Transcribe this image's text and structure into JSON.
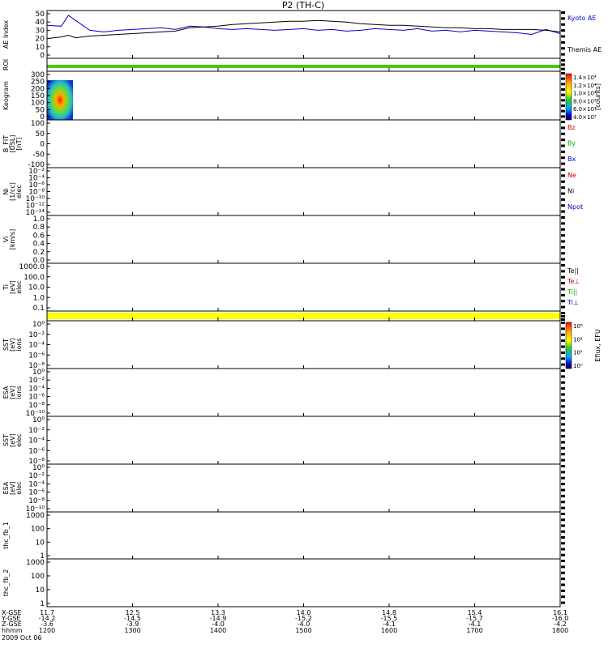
{
  "title": "P2 (TH-C)",
  "colors": {
    "kyoto": "#0000cc",
    "themis": "#000000",
    "bz": "#cc0000",
    "by": "#00aa00",
    "bx": "#0000cc",
    "ne": "#cc0000",
    "ni": "#000000",
    "npot": "#0000cc",
    "tepar": "#000000",
    "teperp": "#cc0000",
    "tipar": "#00aa00",
    "tiperp": "#0000cc",
    "roi_bar": "#44cc00",
    "mode_bar": "#ffff00"
  },
  "panels": [
    {
      "id": "ae",
      "label_lines": [
        "AE Index"
      ],
      "ticks": [
        "50",
        "40",
        "30",
        "20",
        "10",
        "0"
      ],
      "legend": [
        {
          "text": "Kyoto AE",
          "color": "#0000cc"
        },
        {
          "text": "Themis AE",
          "color": "#000000"
        }
      ]
    },
    {
      "id": "roi",
      "label_lines": [
        "ROI"
      ],
      "ticks": [],
      "legend": []
    },
    {
      "id": "keogram",
      "label_lines": [
        "Keogram"
      ],
      "ticks": [
        "300",
        "250",
        "200",
        "150",
        "100",
        "50",
        "0"
      ],
      "legend": []
    },
    {
      "id": "bfit",
      "label_lines": [
        "B_FIT",
        "[DSL]",
        "[nT]"
      ],
      "ticks": [
        "100",
        "50",
        "0",
        "-50",
        "-100"
      ],
      "legend": [
        {
          "text": "Bz",
          "color": "#cc0000"
        },
        {
          "text": "By",
          "color": "#00aa00"
        },
        {
          "text": "Bx",
          "color": "#0000cc"
        }
      ]
    },
    {
      "id": "ni",
      "label_lines": [
        "Ni",
        "[1/cc]",
        "elec"
      ],
      "ticks": [
        "10⁻²",
        "10⁻⁴",
        "10⁻⁶",
        "10⁻⁸",
        "10⁻¹⁰",
        "10⁻¹²",
        "10⁻¹⁴"
      ],
      "legend": [
        {
          "text": "Ne",
          "color": "#cc0000"
        },
        {
          "text": "Ni",
          "color": "#000000"
        },
        {
          "text": "Npot",
          "color": "#0000cc"
        }
      ]
    },
    {
      "id": "vi",
      "label_lines": [
        "Vi",
        "[km/s]"
      ],
      "ticks": [
        "1.0",
        "0.8",
        "0.6",
        "0.4",
        "0.2",
        "0.0"
      ],
      "legend": []
    },
    {
      "id": "ti",
      "label_lines": [
        "Ti",
        "[eV]",
        "elec"
      ],
      "ticks": [
        "1000.0",
        "100.0",
        "10.0",
        "1.0",
        "0.1"
      ],
      "legend": [
        {
          "text": "Te||",
          "color": "#000000"
        },
        {
          "text": "Te⊥",
          "color": "#cc0000"
        },
        {
          "text": "Ti||",
          "color": "#00aa00"
        },
        {
          "text": "Ti⊥",
          "color": "#0000cc"
        }
      ]
    },
    {
      "id": "mode",
      "label_lines": [],
      "ticks": [],
      "legend": []
    },
    {
      "id": "sst1",
      "label_lines": [
        "SST",
        "[eV]",
        "ions"
      ],
      "ticks": [
        "10⁰",
        "10⁻²",
        "10⁻⁴",
        "10⁻⁶",
        "10⁻⁸"
      ],
      "legend": []
    },
    {
      "id": "esa1",
      "label_lines": [
        "ESA",
        "[eV]",
        "ions"
      ],
      "ticks": [
        "10⁰",
        "10⁻²",
        "10⁻⁴",
        "10⁻⁶",
        "10⁻⁸",
        "10⁻¹⁰"
      ],
      "legend": []
    },
    {
      "id": "sst2",
      "label_lines": [
        "SST",
        "[eV]",
        "elec"
      ],
      "ticks": [
        "10⁰",
        "10⁻²",
        "10⁻⁴",
        "10⁻⁶",
        "10⁻⁸"
      ],
      "legend": []
    },
    {
      "id": "esa2",
      "label_lines": [
        "ESA",
        "[eV]",
        "elec"
      ],
      "ticks": [
        "10⁰",
        "10⁻²",
        "10⁻⁴",
        "10⁻⁶",
        "10⁻⁸",
        "10⁻¹⁰"
      ],
      "legend": []
    },
    {
      "id": "fb1",
      "label_lines": [
        "thc_fb_1"
      ],
      "ticks": [
        "1000",
        "100",
        "10",
        "1"
      ],
      "legend": []
    },
    {
      "id": "fb2",
      "label_lines": [
        "thc_fb_2"
      ],
      "ticks": [
        "1000",
        "100",
        "10",
        "1"
      ],
      "legend": []
    }
  ],
  "colorbars": [
    {
      "id": "keogram_cb",
      "title": "[counts]",
      "ticks": [
        "1.4×10⁴",
        "1.2×10⁴",
        "1.0×10⁴",
        "8.0×10³",
        "6.0×10³",
        "4.0×10³"
      ]
    },
    {
      "id": "eflux_cb",
      "title": "Eflux, EFU",
      "ticks": [
        "10⁸",
        "10⁴",
        "10²",
        "10⁰"
      ]
    }
  ],
  "x_axis": {
    "row_labels": [
      "X-GSE",
      "Y-GSE",
      "Z-GSE",
      "hhmm",
      "2009 Oct 06"
    ],
    "columns": [
      {
        "x": "11.7",
        "y": "-14.2",
        "z": "-3.6",
        "t": "1200"
      },
      {
        "x": "12.5",
        "y": "-14.5",
        "z": "-3.9",
        "t": "1300"
      },
      {
        "x": "13.3",
        "y": "-14.9",
        "z": "-4.0",
        "t": "1400"
      },
      {
        "x": "14.0",
        "y": "-15.2",
        "z": "-4.0",
        "t": "1500"
      },
      {
        "x": "14.8",
        "y": "-15.5",
        "z": "-4.1",
        "t": "1600"
      },
      {
        "x": "15.4",
        "y": "-15.7",
        "z": "-4.1",
        "t": "1700"
      },
      {
        "x": "16.1",
        "y": "-16.0",
        "z": "-4.2",
        "t": "1800"
      }
    ]
  },
  "chart_data": {
    "type": "line",
    "title": "P2 (TH-C)",
    "xlabel": "hhmm",
    "x_range": [
      1200,
      1800
    ],
    "ylabel": "AE Index",
    "ylim": [
      0,
      50
    ],
    "x": [
      1200,
      1210,
      1215,
      1220,
      1230,
      1240,
      1250,
      1300,
      1310,
      1320,
      1330,
      1340,
      1350,
      1400,
      1410,
      1420,
      1430,
      1440,
      1450,
      1500,
      1510,
      1520,
      1530,
      1540,
      1550,
      1600,
      1610,
      1620,
      1630,
      1640,
      1650,
      1700,
      1710,
      1720,
      1730,
      1740,
      1750,
      1800
    ],
    "series": [
      {
        "name": "Kyoto AE",
        "values": [
          36,
          35,
          48,
          42,
          30,
          28,
          30,
          31,
          32,
          33,
          31,
          35,
          34,
          32,
          31,
          32,
          31,
          30,
          31,
          32,
          30,
          31,
          29,
          30,
          32,
          31,
          30,
          32,
          29,
          30,
          28,
          30,
          29,
          28,
          27,
          25,
          31,
          26
        ]
      },
      {
        "name": "Themis AE",
        "values": [
          20,
          22,
          24,
          21,
          23,
          24,
          25,
          26,
          27,
          28,
          29,
          33,
          34,
          35,
          37,
          38,
          39,
          40,
          41,
          41,
          42,
          41,
          40,
          38,
          37,
          36,
          36,
          35,
          34,
          33,
          33,
          32,
          32,
          31,
          31,
          31,
          30,
          28
        ]
      }
    ]
  }
}
